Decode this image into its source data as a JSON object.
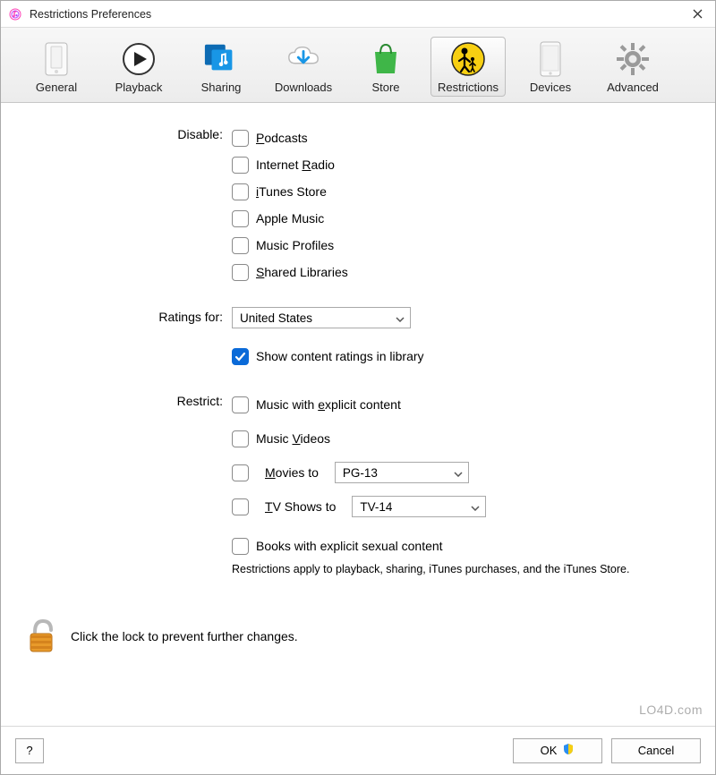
{
  "window": {
    "title": "Restrictions Preferences"
  },
  "toolbar": {
    "items": [
      {
        "id": "general",
        "label": "General"
      },
      {
        "id": "playback",
        "label": "Playback"
      },
      {
        "id": "sharing",
        "label": "Sharing"
      },
      {
        "id": "downloads",
        "label": "Downloads"
      },
      {
        "id": "store",
        "label": "Store"
      },
      {
        "id": "restrictions",
        "label": "Restrictions",
        "selected": true
      },
      {
        "id": "devices",
        "label": "Devices"
      },
      {
        "id": "advanced",
        "label": "Advanced"
      }
    ]
  },
  "sections": {
    "disable": {
      "label": "Disable:",
      "items": [
        {
          "id": "podcasts",
          "label": "Podcasts",
          "checked": false
        },
        {
          "id": "internet-radio",
          "label": "Internet Radio",
          "checked": false
        },
        {
          "id": "itunes-store",
          "label": "iTunes Store",
          "checked": false
        },
        {
          "id": "apple-music",
          "label": "Apple Music",
          "checked": false
        },
        {
          "id": "music-profiles",
          "label": "Music Profiles",
          "checked": false
        },
        {
          "id": "shared-libraries",
          "label": "Shared Libraries",
          "checked": false
        }
      ]
    },
    "ratings": {
      "label": "Ratings for:",
      "country": "United States",
      "show_ratings": {
        "label": "Show content ratings in library",
        "checked": true
      }
    },
    "restrict": {
      "label": "Restrict:",
      "explicit_music": {
        "label": "Music with explicit content",
        "checked": false
      },
      "music_videos": {
        "label": "Music Videos",
        "checked": false
      },
      "movies": {
        "label": "Movies to",
        "checked": false,
        "value": "PG-13"
      },
      "tv": {
        "label": "TV Shows to",
        "checked": false,
        "value": "TV-14"
      },
      "books": {
        "label": "Books with explicit sexual content",
        "checked": false
      },
      "note": "Restrictions apply to playback, sharing, iTunes purchases, and the iTunes Store."
    }
  },
  "lock": {
    "text": "Click the lock to prevent further changes."
  },
  "footer": {
    "help": "?",
    "ok": "OK",
    "cancel": "Cancel"
  },
  "watermark": "LO4D.com"
}
